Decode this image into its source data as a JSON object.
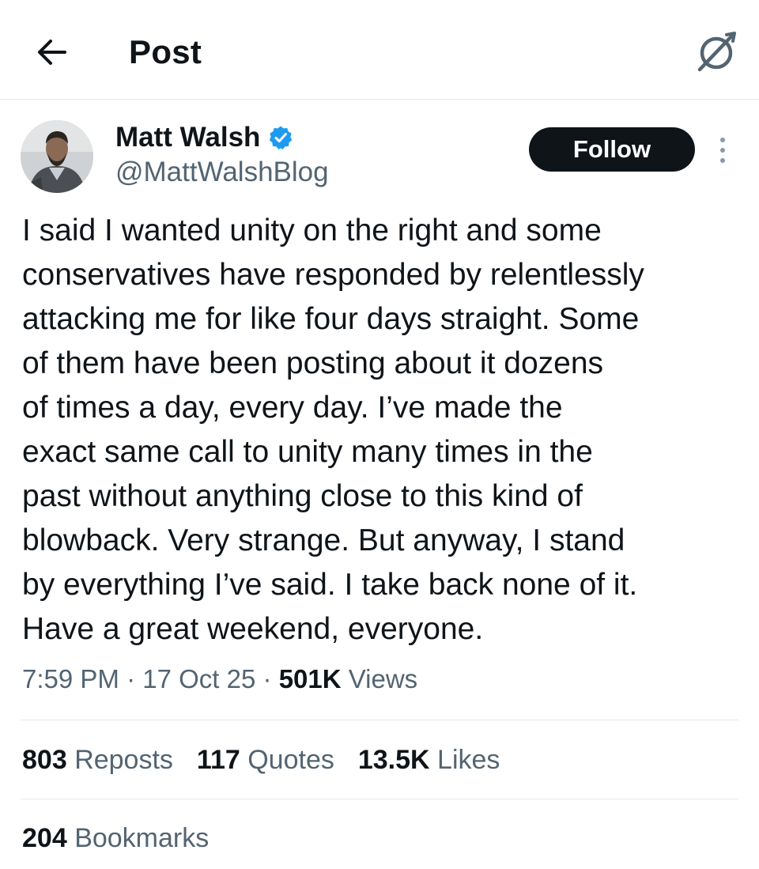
{
  "header": {
    "title": "Post",
    "back_icon": "arrow-left-icon",
    "grok_icon": "grok-icon"
  },
  "author": {
    "name": "Matt Walsh",
    "handle": "@MattWalshBlog",
    "verified_color": "#1d9bf0",
    "follow_label": "Follow"
  },
  "post": {
    "text": "I said I wanted unity on the right and some\nconservatives have responded by relentlessly\nattacking me for like four days straight. Some\nof them have been posting about it dozens\nof times a day, every day. I’ve made the\nexact same call to unity many times in the\npast without anything close to this kind of\nblowback. Very strange. But anyway, I stand\nby everything I’ve said. I take back none of it.\nHave a great weekend, everyone.",
    "time": "7:59 PM",
    "date": "17 Oct 25",
    "views_count": "501K",
    "views_label": "Views"
  },
  "stats": {
    "reposts_count": "803",
    "reposts_label": "Reposts",
    "quotes_count": "117",
    "quotes_label": "Quotes",
    "likes_count": "13.5K",
    "likes_label": "Likes",
    "bookmarks_count": "204",
    "bookmarks_label": "Bookmarks"
  }
}
